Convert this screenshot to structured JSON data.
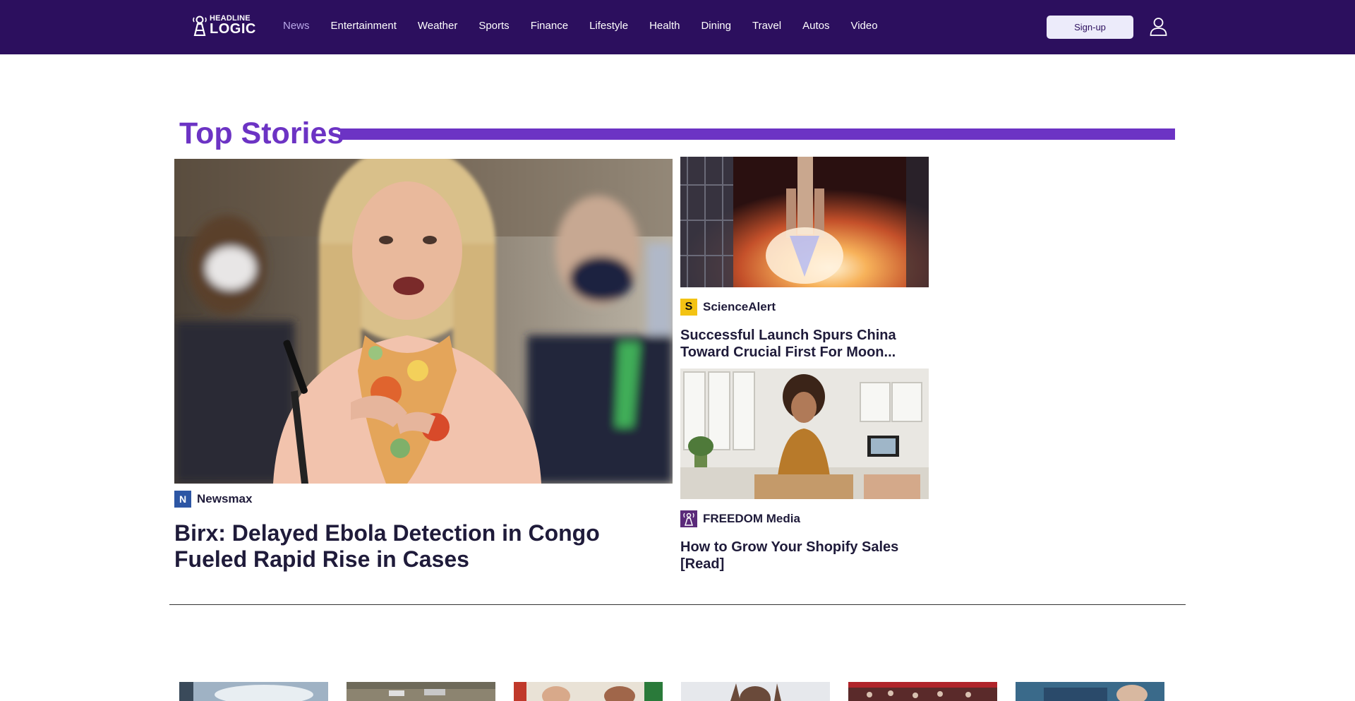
{
  "header": {
    "logo": {
      "line1": "HEADLINE",
      "line2": "LOGIC",
      "icon": "lighthouse-icon"
    },
    "nav": [
      {
        "label": "News",
        "active": true
      },
      {
        "label": "Entertainment"
      },
      {
        "label": "Weather"
      },
      {
        "label": "Sports"
      },
      {
        "label": "Finance"
      },
      {
        "label": "Lifestyle"
      },
      {
        "label": "Health"
      },
      {
        "label": "Dining"
      },
      {
        "label": "Travel"
      },
      {
        "label": "Autos"
      },
      {
        "label": "Video"
      }
    ],
    "signup_label": "Sign-up",
    "user_icon": "user-icon"
  },
  "top_stories": {
    "title": "Top Stories",
    "main": {
      "source": "Newsmax",
      "source_logo": "N",
      "headline": "Birx: Delayed Ebola Detection in Congo Fueled Rapid Rise in Cases"
    },
    "side": [
      {
        "source": "ScienceAlert",
        "source_logo": "S",
        "headline": "Successful Launch Spurs China Toward Crucial First For Moon..."
      },
      {
        "source": "FREEDOM Media",
        "source_logo": "tower-icon",
        "headline": "How to Grow Your Shopify Sales [Read]"
      }
    ]
  },
  "colors": {
    "header_bg": "#2c0f5e",
    "accent": "#6c33c4",
    "nav_active": "#b9a8e8",
    "signup_bg": "#ecebfa",
    "text": "#1f1b3a"
  }
}
